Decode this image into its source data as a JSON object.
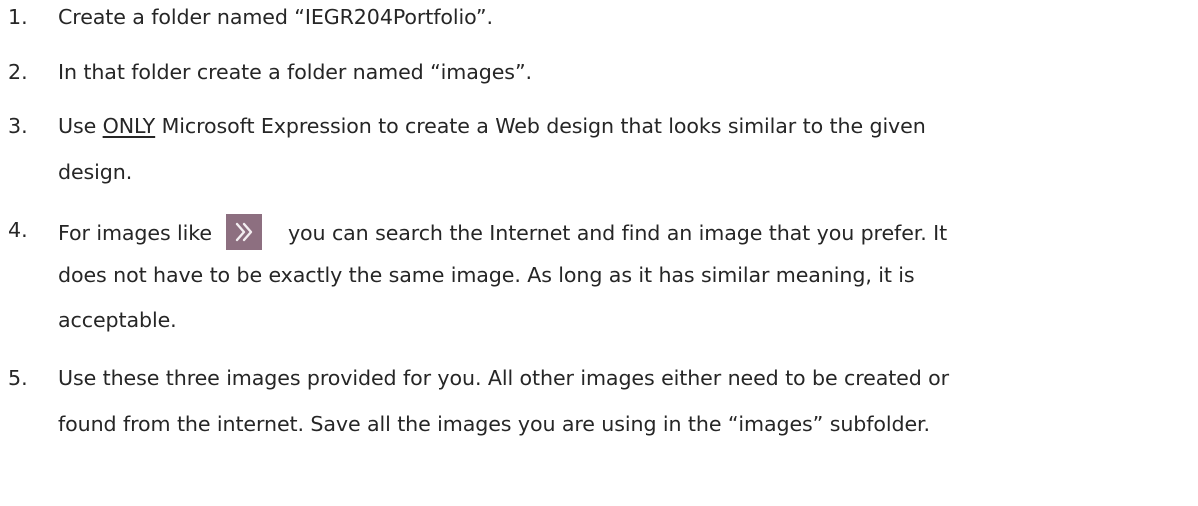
{
  "steps": [
    {
      "number": "1.",
      "lines": [
        "Create a folder named “IEGR204Portfolio”."
      ]
    },
    {
      "number": "2.",
      "lines": [
        "In that folder create a folder named “images”."
      ]
    },
    {
      "number": "3.",
      "prefix": "Use ",
      "underlined": "ONLY",
      "line1_rest": " Microsoft Expression to create a Web design that looks similar to the given",
      "line2": "design."
    },
    {
      "number": "4.",
      "prefix": "For images like",
      "icon": "double-chevron-right-icon",
      "icon_color": "#8d6f80",
      "line1_rest": "you can search the Internet and find an image that you prefer. It",
      "line2": "does not have to be exactly the same image. As long as it has similar meaning, it is",
      "line3": "acceptable."
    },
    {
      "number": "5.",
      "line1": "Use these three images provided for you. All other images either need to be created or",
      "line2": "found from the internet. Save all the images you are using in the “images” subfolder."
    }
  ]
}
